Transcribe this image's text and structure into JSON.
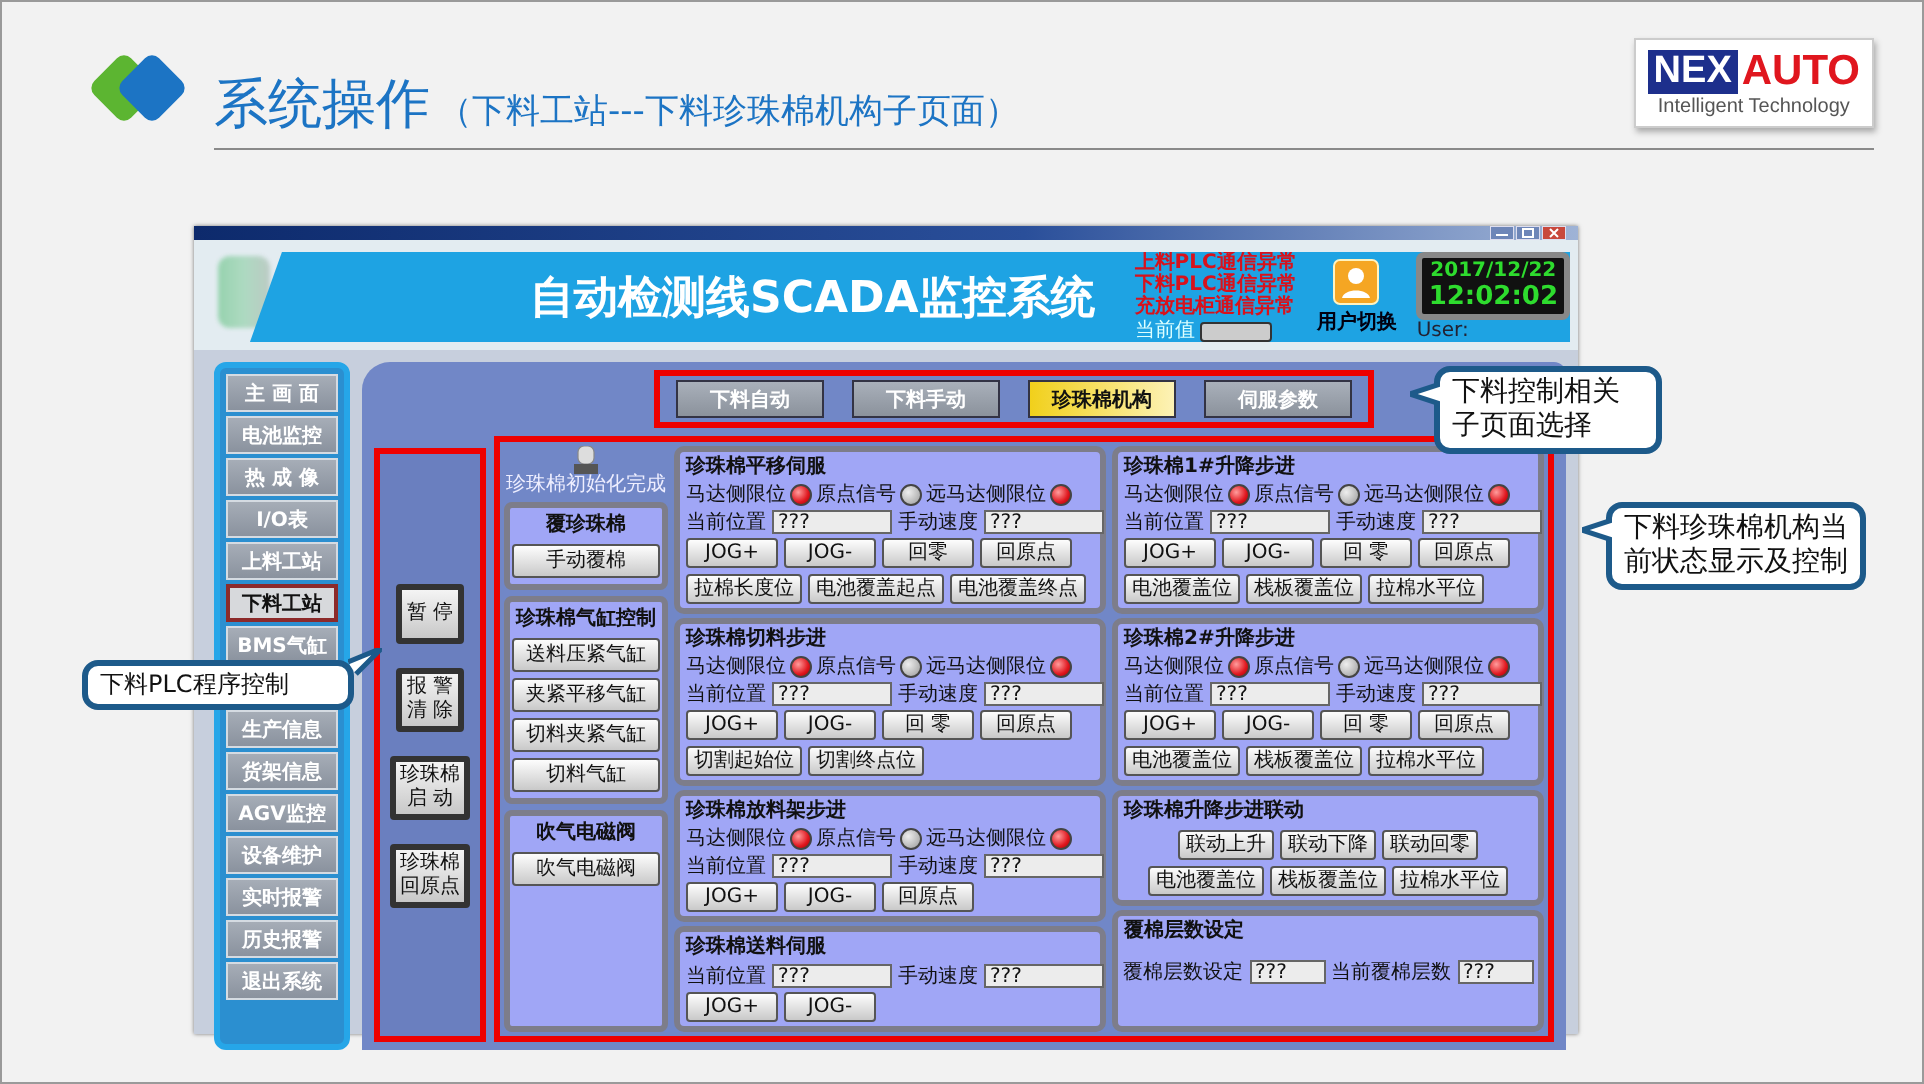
{
  "slide": {
    "title": "系统操作",
    "subtitle": "（下料工站---下料珍珠棉机构子页面）"
  },
  "logo": {
    "mark": "NEX",
    "word": "AUTO",
    "tagline": "Intelligent Technology"
  },
  "window": {
    "title": "自动检测线SCADA监控系统",
    "alarms": [
      "上料PLC通信异常",
      "下料PLC通信异常",
      "充放电柜通信异常"
    ],
    "value_label": "当前值",
    "user_switch": "用户切换",
    "user_label": "User:",
    "date": "2017/12/22",
    "time": "12:02:02"
  },
  "sidebar": {
    "items": [
      {
        "label": "主 画 面",
        "selected": false
      },
      {
        "label": "电池监控",
        "selected": false
      },
      {
        "label": "热 成 像",
        "selected": false
      },
      {
        "label": "I/O表",
        "selected": false
      },
      {
        "label": "上料工站",
        "selected": false
      },
      {
        "label": "下料工站",
        "selected": true
      },
      {
        "label": "BMS气缸",
        "selected": false
      },
      {
        "label": "生产信息",
        "selected": false
      },
      {
        "label": "货架信息",
        "selected": false
      },
      {
        "label": "AGV监控",
        "selected": false
      },
      {
        "label": "设备维护",
        "selected": false
      },
      {
        "label": "实时报警",
        "selected": false
      },
      {
        "label": "历史报警",
        "selected": false
      },
      {
        "label": "退出系统",
        "selected": false
      }
    ]
  },
  "tabs": [
    {
      "label": "下料自动",
      "selected": false
    },
    {
      "label": "下料手动",
      "selected": false
    },
    {
      "label": "珍珠棉机构",
      "selected": true
    },
    {
      "label": "伺服参数",
      "selected": false
    }
  ],
  "plc_controls": [
    {
      "lines": [
        "暂 停"
      ]
    },
    {
      "lines": [
        "报 警",
        "清 除"
      ]
    },
    {
      "lines": [
        "珍珠棉",
        "启 动"
      ]
    },
    {
      "lines": [
        "珍珠棉",
        "回原点"
      ]
    }
  ],
  "init_indicator": {
    "label": "珍珠棉初始化完成"
  },
  "left_panels": [
    {
      "title": "覆珍珠棉",
      "buttons": [
        "手动覆棉"
      ]
    },
    {
      "title": "珍珠棉气缸控制",
      "buttons": [
        "送料压紧气缸",
        "夹紧平移气缸",
        "切料夹紧气缸",
        "切料气缸"
      ]
    },
    {
      "title": "吹气电磁阀",
      "buttons": [
        "吹气电磁阀"
      ]
    }
  ],
  "middle_column": [
    {
      "kind": "axis",
      "title": "珍珠棉平移伺服",
      "lamps": [
        {
          "label": "马达侧限位",
          "on": true
        },
        {
          "label": "原点信号",
          "on": false
        },
        {
          "label": "远马达侧限位",
          "on": true
        }
      ],
      "fields": [
        {
          "label": "当前位置",
          "value": "???"
        },
        {
          "label": "手动速度",
          "value": "???"
        }
      ],
      "button_rows": [
        [
          "JOG+",
          "JOG-",
          "回零",
          "回原点"
        ],
        [
          "拉棉长度位",
          "电池覆盖起点",
          "电池覆盖终点"
        ]
      ]
    },
    {
      "kind": "axis",
      "title": "珍珠棉切料步进",
      "lamps": [
        {
          "label": "马达侧限位",
          "on": true
        },
        {
          "label": "原点信号",
          "on": false
        },
        {
          "label": "远马达侧限位",
          "on": true
        }
      ],
      "fields": [
        {
          "label": "当前位置",
          "value": "???"
        },
        {
          "label": "手动速度",
          "value": "???"
        }
      ],
      "button_rows": [
        [
          "JOG+",
          "JOG-",
          "回 零",
          "回原点"
        ],
        [
          "切割起始位",
          "切割终点位"
        ]
      ]
    },
    {
      "kind": "axis",
      "title": "珍珠棉放料架步进",
      "lamps": [
        {
          "label": "马达侧限位",
          "on": true
        },
        {
          "label": "原点信号",
          "on": false
        },
        {
          "label": "远马达侧限位",
          "on": true
        }
      ],
      "fields": [
        {
          "label": "当前位置",
          "value": "???"
        },
        {
          "label": "手动速度",
          "value": "???"
        }
      ],
      "button_rows": [
        [
          "JOG+",
          "JOG-",
          "回原点"
        ]
      ]
    },
    {
      "kind": "axis",
      "title": "珍珠棉送料伺服",
      "fields": [
        {
          "label": "当前位置",
          "value": "???"
        },
        {
          "label": "手动速度",
          "value": "???"
        }
      ],
      "button_rows": [
        [
          "JOG+",
          "JOG-"
        ]
      ]
    }
  ],
  "right_column": [
    {
      "kind": "axis",
      "title": "珍珠棉1#升降步进",
      "lamps": [
        {
          "label": "马达侧限位",
          "on": true
        },
        {
          "label": "原点信号",
          "on": false
        },
        {
          "label": "远马达侧限位",
          "on": true
        }
      ],
      "fields": [
        {
          "label": "当前位置",
          "value": "???"
        },
        {
          "label": "手动速度",
          "value": "???"
        }
      ],
      "button_rows": [
        [
          "JOG+",
          "JOG-",
          "回 零",
          "回原点"
        ],
        [
          "电池覆盖位",
          "栈板覆盖位",
          "拉棉水平位"
        ]
      ]
    },
    {
      "kind": "axis",
      "title": "珍珠棉2#升降步进",
      "lamps": [
        {
          "label": "马达侧限位",
          "on": true
        },
        {
          "label": "原点信号",
          "on": false
        },
        {
          "label": "远马达侧限位",
          "on": true
        }
      ],
      "fields": [
        {
          "label": "当前位置",
          "value": "???"
        },
        {
          "label": "手动速度",
          "value": "???"
        }
      ],
      "button_rows": [
        [
          "JOG+",
          "JOG-",
          "回 零",
          "回原点"
        ],
        [
          "电池覆盖位",
          "栈板覆盖位",
          "拉棉水平位"
        ]
      ]
    },
    {
      "kind": "linkage",
      "title": "珍珠棉升降步进联动",
      "button_rows": [
        [
          "联动上升",
          "联动下降",
          "联动回零"
        ],
        [
          "电池覆盖位",
          "栈板覆盖位",
          "拉棉水平位"
        ]
      ]
    },
    {
      "kind": "setting",
      "title": "覆棉层数设定",
      "fields": [
        {
          "label": "覆棉层数设定",
          "value": "???"
        },
        {
          "label": "当前覆棉层数",
          "value": "???"
        }
      ]
    }
  ],
  "callouts": [
    {
      "text": "下料控制相关子页面选择"
    },
    {
      "text": "下料珍珠棉机构当前状态显示及控制"
    },
    {
      "text": "下料PLC程序控制"
    }
  ]
}
